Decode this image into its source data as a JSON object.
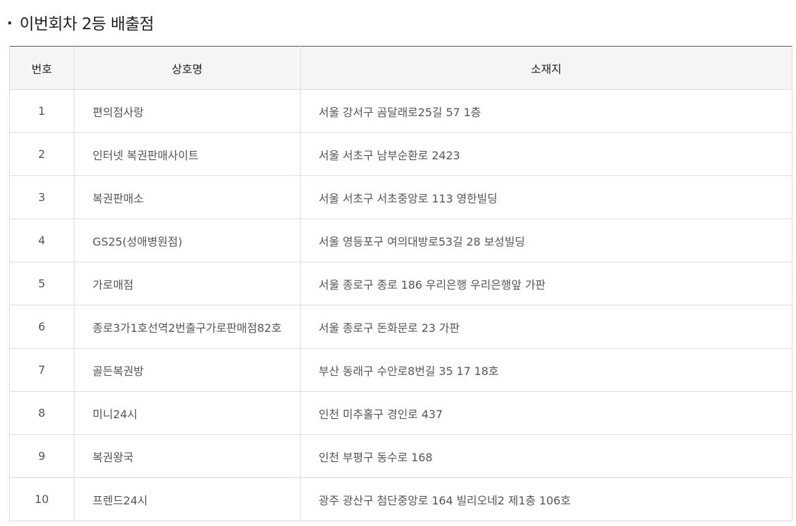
{
  "section": {
    "title": "이번회차 2등 배출점"
  },
  "table": {
    "headers": {
      "no": "번호",
      "name": "상호명",
      "address": "소재지"
    },
    "rows": [
      {
        "no": "1",
        "name": "편의점사랑",
        "address": "서울 강서구 곰달래로25길 57 1층"
      },
      {
        "no": "2",
        "name": "인터넷 복권판매사이트",
        "address": "서울 서초구 남부순환로 2423"
      },
      {
        "no": "3",
        "name": "복권판매소",
        "address": "서울 서초구 서초중앙로 113 영한빌딩"
      },
      {
        "no": "4",
        "name": "GS25(성애병원점)",
        "address": "서울 영등포구 여의대방로53길 28 보성빌딩"
      },
      {
        "no": "5",
        "name": "가로매점",
        "address": "서울 종로구 종로 186 우리은행 우리은행앞 가판"
      },
      {
        "no": "6",
        "name": "종로3가1호선역2번출구가로판매점82호",
        "address": "서울 종로구 돈화문로 23 가판"
      },
      {
        "no": "7",
        "name": "골든복권방",
        "address": "부산 동래구 수안로8번길 35 17 18호"
      },
      {
        "no": "8",
        "name": "미니24시",
        "address": "인천 미추홀구 경인로 437"
      },
      {
        "no": "9",
        "name": "복권왕국",
        "address": "인천 부평구 동수로 168"
      },
      {
        "no": "10",
        "name": "프렌드24시",
        "address": "광주 광산구 첨단중앙로 164 빌리오네2 제1층 106호"
      }
    ]
  },
  "colors": {
    "header_bg": "#f5f5f5",
    "border": "#dddddd",
    "top_border": "#555555",
    "text": "#555555"
  }
}
